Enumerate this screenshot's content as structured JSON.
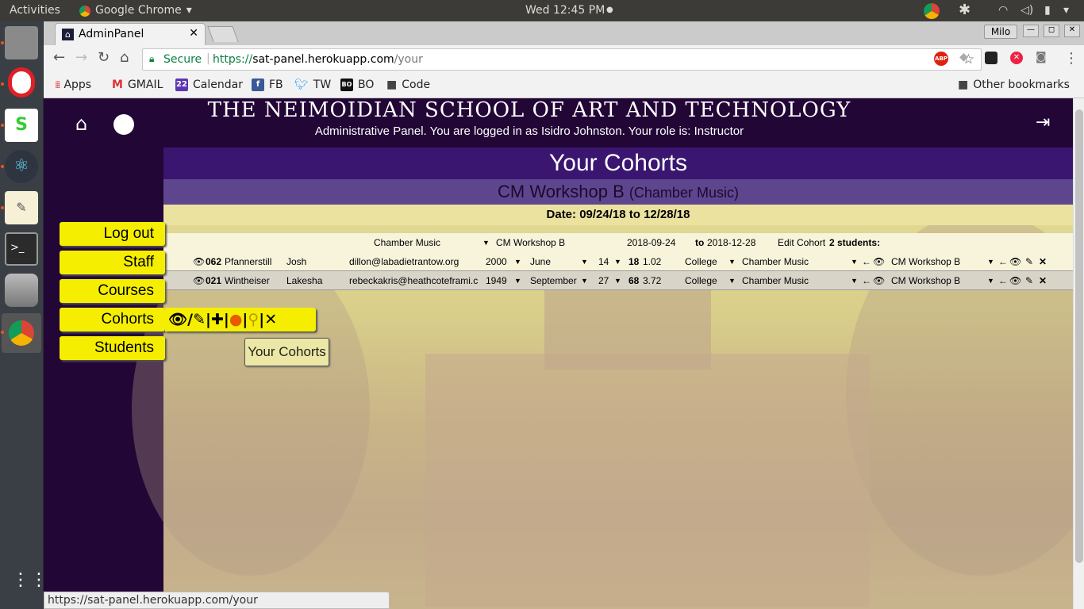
{
  "topbar": {
    "activities": "Activities",
    "app": "Google Chrome",
    "clock": "Wed 12:45 PM"
  },
  "dock": {
    "items": [
      "files-icon",
      "opera-icon",
      "slack-icon",
      "atom-icon",
      "text-editor-icon",
      "terminal-icon",
      "database-icon",
      "chrome-icon"
    ],
    "apps_grid": "apps-grid-icon"
  },
  "browser": {
    "tab_title": "AdminPanel",
    "user": "Milo",
    "secure": "Secure",
    "url_prefix": "https://",
    "url_host": "sat-panel.herokuapp.com",
    "url_path": "/your",
    "bookmarks": [
      {
        "label": "Apps",
        "icon": "apps-icon"
      },
      {
        "label": "GMAIL",
        "icon": "gmail-icon"
      },
      {
        "label": "Calendar",
        "icon": "calendar-icon"
      },
      {
        "label": "FB",
        "icon": "facebook-icon"
      },
      {
        "label": "TW",
        "icon": "twitter-icon"
      },
      {
        "label": "BO",
        "icon": "bo-icon"
      },
      {
        "label": "Code",
        "icon": "folder-icon"
      }
    ],
    "other_bookmarks": "Other bookmarks",
    "status_url": "https://sat-panel.herokuapp.com/your"
  },
  "header": {
    "title": "THE NEIMOIDIAN SCHOOL OF ART AND TECHNOLOGY",
    "subtitle": "Administrative Panel. You are logged in as Isidro Johnston. Your role is: Instructor"
  },
  "main": {
    "heading": "Your Cohorts",
    "cohort_name": "CM Workshop B",
    "cohort_subject": "(Chamber Music)",
    "date": "Date: 09/24/18 to 12/28/18",
    "edit_bar": {
      "course": "Chamber Music",
      "cohort": "CM Workshop B",
      "start": "2018-09-24",
      "to": "to",
      "end": "2018-12-28",
      "edit": "Edit Cohort",
      "count": "2 students:"
    },
    "students": [
      {
        "id": "062",
        "last": "Pfannerstill",
        "first": "Josh",
        "email": "dillon@labadietrantow.org",
        "year": "2000",
        "month": "June",
        "day": "14",
        "age": "18",
        "gpa": "1.02",
        "level": "College",
        "course": "Chamber Music",
        "cohort": "CM Workshop B"
      },
      {
        "id": "021",
        "last": "Wintheiser",
        "first": "Lakesha",
        "email": "rebeckakris@heathcoteframi.c",
        "year": "1949",
        "month": "September",
        "day": "27",
        "age": "68",
        "gpa": "3.72",
        "level": "College",
        "course": "Chamber Music",
        "cohort": "CM Workshop B"
      }
    ]
  },
  "nav": {
    "logout": "Log out",
    "staff": "Staff",
    "courses": "Courses",
    "cohorts": "Cohorts",
    "students": "Students"
  },
  "tooltip": "Your Cohorts",
  "colors": {
    "nav_yellow": "#f5ee00",
    "header_purple": "#220636",
    "heading_band": "#3a1670",
    "cohort_band": "#5e468f"
  }
}
